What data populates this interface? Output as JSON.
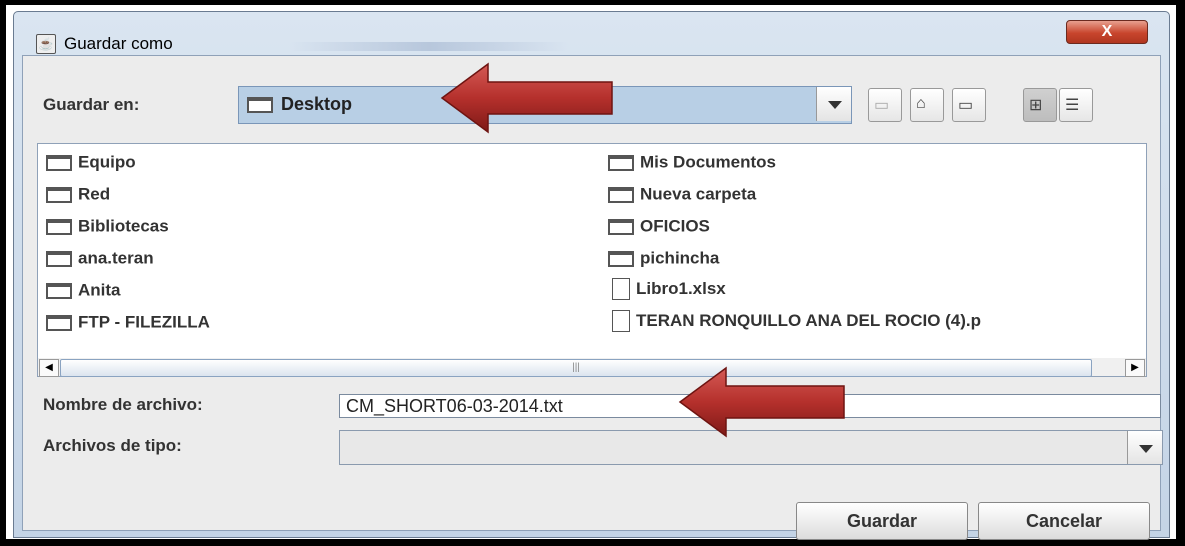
{
  "window": {
    "title": "Guardar como",
    "close_symbol": "X"
  },
  "look_in": {
    "label": "Guardar en:",
    "value": "Desktop"
  },
  "toolbar": {
    "icons": [
      "up-folder-icon",
      "home-icon",
      "new-folder-icon",
      "list-view-icon",
      "details-view-icon"
    ]
  },
  "files": {
    "left": [
      {
        "name": "Equipo",
        "type": "folder"
      },
      {
        "name": "Red",
        "type": "folder"
      },
      {
        "name": "Bibliotecas",
        "type": "folder"
      },
      {
        "name": "ana.teran",
        "type": "folder"
      },
      {
        "name": "Anita",
        "type": "folder"
      },
      {
        "name": "FTP - FILEZILLA",
        "type": "folder"
      }
    ],
    "right": [
      {
        "name": "Mis Documentos",
        "type": "folder"
      },
      {
        "name": "Nueva carpeta",
        "type": "folder"
      },
      {
        "name": "OFICIOS",
        "type": "folder"
      },
      {
        "name": "pichincha",
        "type": "folder"
      },
      {
        "name": "Libro1.xlsx",
        "type": "file"
      },
      {
        "name": "TERAN RONQUILLO ANA DEL ROCIO (4).p",
        "type": "file"
      }
    ]
  },
  "file_name": {
    "label": "Nombre de archivo:",
    "value": "CM_SHORT06-03-2014.txt"
  },
  "file_type": {
    "label": "Archivos de tipo:",
    "value": ""
  },
  "buttons": {
    "save": "Guardar",
    "cancel": "Cancelar"
  },
  "colors": {
    "arrow": "#b8322f",
    "close": "#c8452d",
    "combo_selected": "#b8cfe5"
  }
}
